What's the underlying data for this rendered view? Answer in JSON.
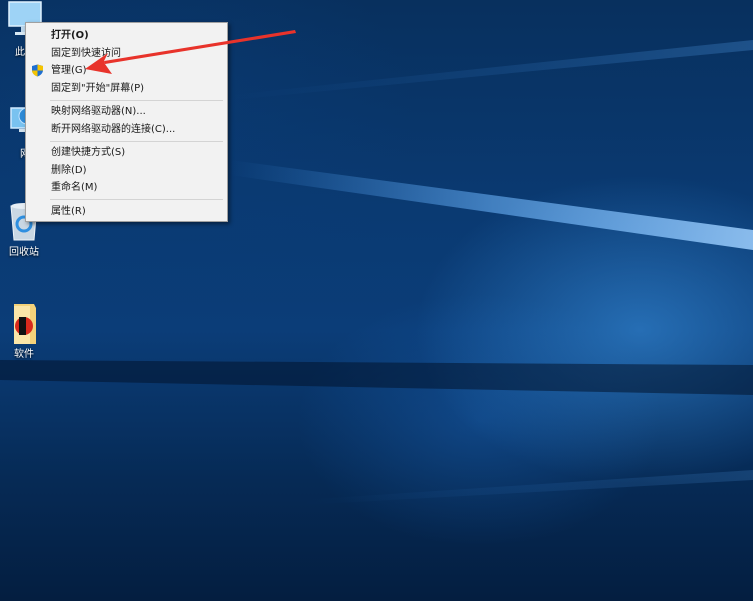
{
  "desktop": {
    "icons": [
      {
        "name": "this-pc",
        "label": "此电"
      },
      {
        "name": "network",
        "label": "网"
      },
      {
        "name": "recycle-bin",
        "label": "回收站"
      },
      {
        "name": "software-folder",
        "label": "软件"
      }
    ]
  },
  "context_menu": {
    "items": [
      {
        "label": "打开(O)",
        "bold": true
      },
      {
        "label": "固定到快速访问"
      },
      {
        "label": "管理(G)",
        "icon": "uac-shield-icon"
      },
      {
        "label": "固定到\"开始\"屏幕(P)"
      },
      {
        "label": "映射网络驱动器(N)..."
      },
      {
        "label": "断开网络驱动器的连接(C)..."
      },
      {
        "label": "创建快捷方式(S)"
      },
      {
        "label": "删除(D)"
      },
      {
        "label": "重命名(M)"
      },
      {
        "label": "属性(R)"
      }
    ]
  },
  "colors": {
    "menu_bg": "#f2f2f2",
    "annotation_arrow": "#e8332b",
    "desktop_blue": "#0b3d78"
  }
}
